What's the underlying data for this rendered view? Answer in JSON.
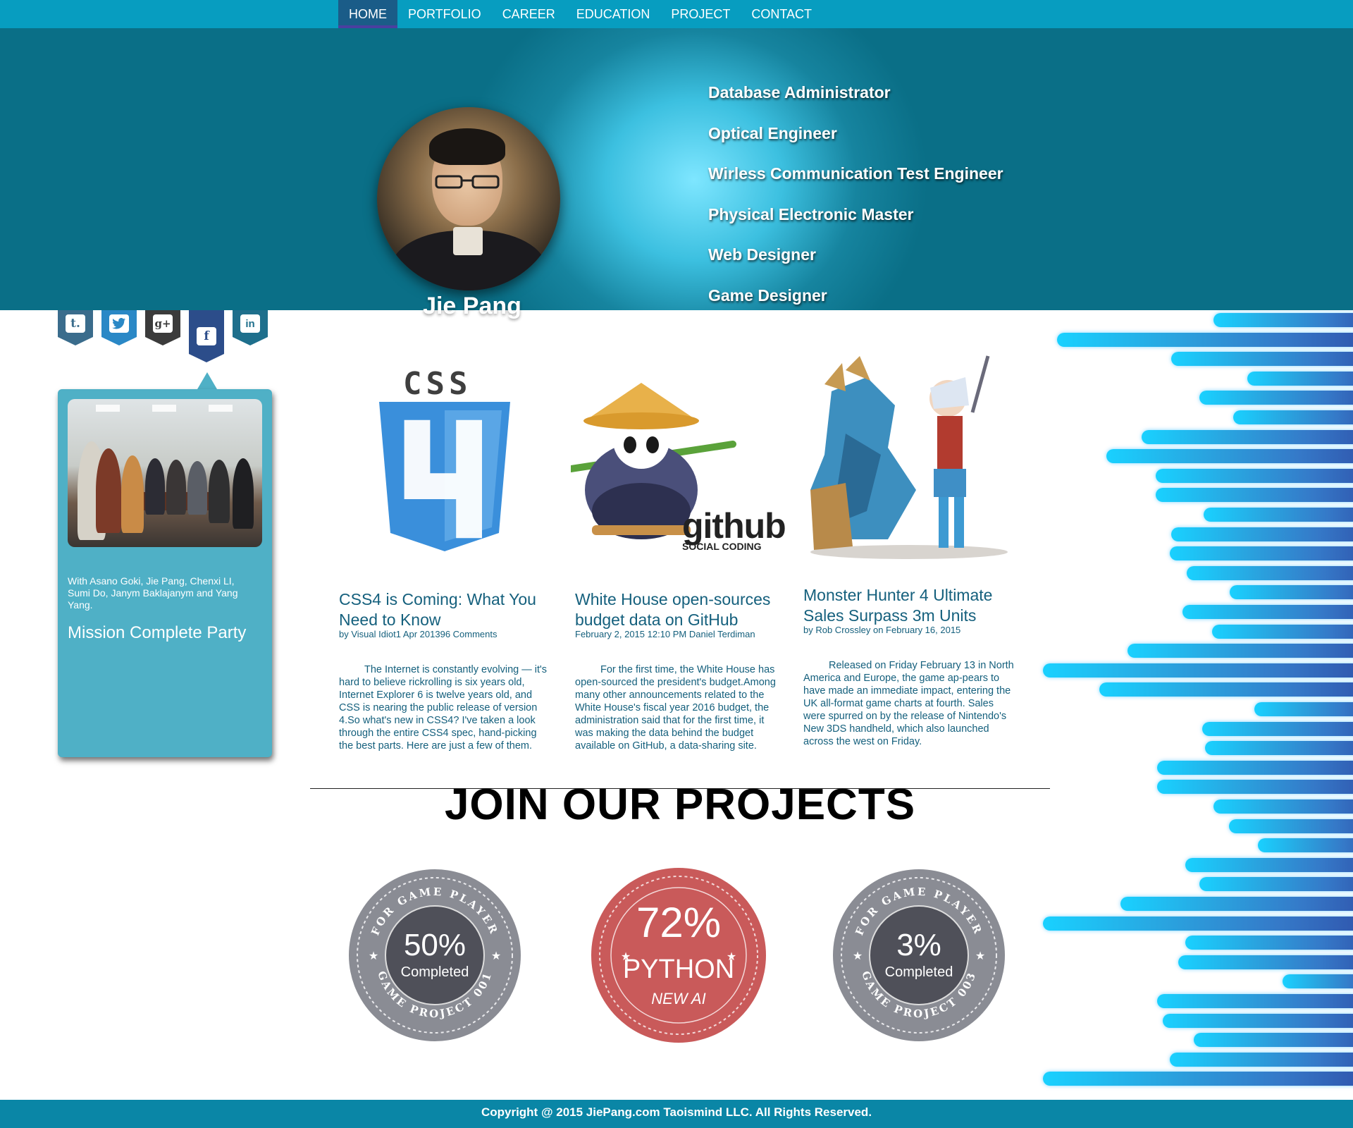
{
  "nav": {
    "items": [
      {
        "label": "HOME",
        "active": true
      },
      {
        "label": "PORTFOLIO",
        "active": false
      },
      {
        "label": "CAREER",
        "active": false
      },
      {
        "label": "EDUCATION",
        "active": false
      },
      {
        "label": "PROJECT",
        "active": false
      },
      {
        "label": "CONTACT",
        "active": false
      }
    ]
  },
  "hero": {
    "name": "Jie Pang",
    "roles": [
      "Database Administrator",
      "Optical Engineer",
      "Wirless Communication Test Engineer",
      "Physical Electronic Master",
      "Web Designer",
      "Game Designer"
    ]
  },
  "social": {
    "icons": [
      "tumblr-icon",
      "twitter-icon",
      "google-plus-icon",
      "facebook-icon",
      "linkedin-icon"
    ],
    "glyphs": [
      "t.",
      "🐦",
      "g+",
      "f",
      "in"
    ]
  },
  "sidebar": {
    "description": "With Asano Goki, Jie Pang, Chenxi LI, Sumi Do, Janym Baklajanym and Yang Yang.",
    "title": "Mission Complete Party"
  },
  "articles": [
    {
      "title": "CSS4 is Coming: What You Need to Know",
      "meta": "by Visual Idiot1 Apr 201396 Comments",
      "body": "The Internet is constantly evolving — it's hard to believe rickrolling is six years old, Internet Explorer 6 is twelve years old, and CSS is nearing the public release of version 4.So what's new in CSS4? I've taken a look through the entire CSS4 spec, hand-picking the best parts. Here are just a few of them.",
      "image_label": "CSS"
    },
    {
      "title": "White House open-sources budget data on GitHub",
      "meta": "February 2, 2015 12:10 PM Daniel Terdiman",
      "body": "For the first time, the White House has open-sourced the president's budget.Among many other announcements related to the White House's fiscal year 2016 budget, the administration said that for the first time, it was making the data behind the budget available on GitHub, a data-sharing site.",
      "image_label": "github",
      "image_sublabel": "SOCIAL CODING"
    },
    {
      "title": "Monster Hunter 4 Ultimate Sales Surpass 3m Units",
      "meta": "by Rob Crossley on February 16, 2015",
      "body": "Released on Friday February 13 in North America and Europe, the game ap-pears to have made an immediate impact, entering the UK all-format game charts at fourth. Sales were spurred on by the release of Nintendo's New 3DS handheld, which also launched across the west on Friday."
    }
  ],
  "projects": {
    "heading": "JOIN OUR PROJECTS",
    "badges": [
      {
        "value": "50%",
        "label": "Completed",
        "ring_top": "FOR GAME PLAYER",
        "ring_bottom": "GAME PROJECT 001",
        "color": "#8a8c94"
      },
      {
        "value": "72%",
        "label": "PYTHON",
        "sub": "NEW AI",
        "color": "#c95a5a"
      },
      {
        "value": "3%",
        "label": "Completed",
        "ring_top": "FOR GAME PLAYER",
        "ring_bottom": "GAME PROJECT 003",
        "color": "#8a8c94"
      }
    ]
  },
  "footer": {
    "text": "Copyright @ 2015 JiePang.com Taoismind LLC.  All Rights Reserved."
  },
  "colors": {
    "nav": "#079dc0",
    "hero_light": "#7ee6ff",
    "hero_dark": "#0a6f87",
    "card": "#4fb0c6",
    "text_link": "#15607d",
    "footer": "#0a86a6"
  }
}
